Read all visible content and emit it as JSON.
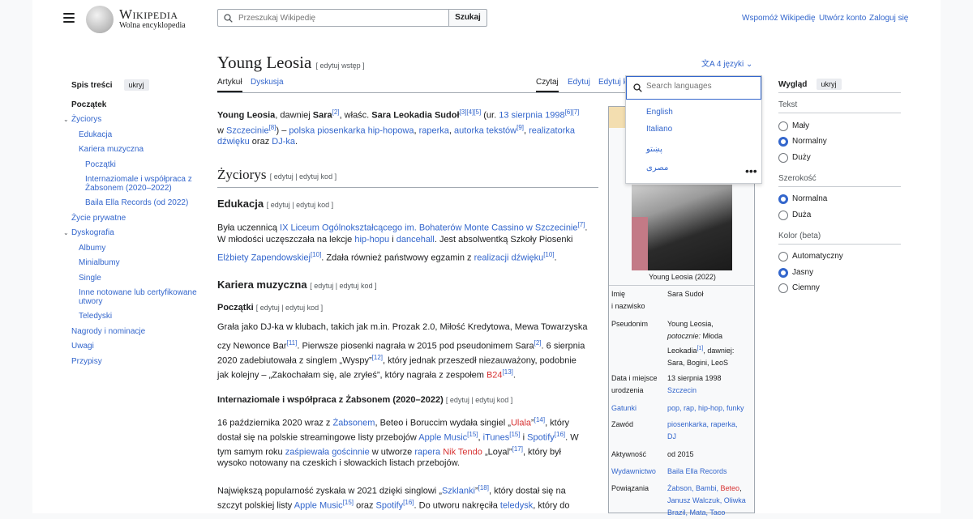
{
  "header": {
    "logo_title": "Wikipedia",
    "logo_subtitle": "Wolna encyklopedia",
    "search_placeholder": "Przeszukaj Wikipedię",
    "search_button": "Szukaj",
    "user_links": [
      "Wspomóż Wikipedię",
      "Utwórz konto",
      "Zaloguj się"
    ]
  },
  "toc": {
    "title": "Spis treści",
    "hide": "ukryj",
    "items": [
      "Początek",
      "Życiorys",
      "Edukacja",
      "Kariera muzyczna",
      "Początki",
      "Internaziomale i współpraca z",
      "Żabsonem (2020–2022)",
      "Baila Ella Records (od 2022)",
      "Życie prywatne",
      "Dyskografia",
      "Albumy",
      "Minialbumy",
      "Single",
      "Inne notowane lub certyfikowane",
      "utwory",
      "Teledyski",
      "Nagrody i nominacje",
      "Uwagi",
      "Przypisy"
    ]
  },
  "article": {
    "title": "Young Leosia",
    "edit_intro": "[ edytuj wstęp ]",
    "edit_links": "[ edytuj | edytuj kod ]",
    "lang_count": "4 języki",
    "tabs_left": [
      "Artykuł",
      "Dyskusja"
    ],
    "tabs_right": [
      "Czytaj",
      "Edytuj",
      "Edytuj k"
    ],
    "intro": {
      "l1a": "Young Leosia",
      "l1b": ", dawniej ",
      "l1c": "Sara",
      "l1d": "[2]",
      "l1e": ", właśc. ",
      "l1f": "Sara Leokadia Sudoł",
      "l1g": "[3][4][5]",
      "l1h": " (ur. ",
      "l1i": "13 sierpnia",
      "l1j": "1998",
      "l1k": "[6][7]",
      "l2a": "w ",
      "l2b": "Szczecinie",
      "l2c": "[8]",
      "l2d": ") – ",
      "l2e": "polska piosenkarka hip-hopowa",
      "l2f": ", ",
      "l2g": "raperka",
      "l2h": ", ",
      "l2i": "autorka tekstów",
      "l2j": "[9]",
      "l2k": ", ",
      "l2l": "realizatorka",
      "l3a": "dźwięku",
      "l3b": " oraz ",
      "l3c": "DJ-ka",
      "l3d": "."
    },
    "h_zyciorys": "Życiorys",
    "h_edukacja": "Edukacja",
    "edukacja": {
      "a1": "Była uczennicą ",
      "a2": "IX Liceum Ogólnokształcącego im. Bohaterów Monte Cassino w Szczecinie",
      "a3": "[7]",
      "a4": ".",
      "b1": "W młodości uczęszczała na lekcje ",
      "b2": "hip-hopu",
      "b3": " i ",
      "b4": "dancehall",
      "b5": ". Jest absolwentką Szkoły Piosenki",
      "c1": "Elżbiety Zapendowskiej",
      "c2": "[10]",
      "c3": ". Zdała również państwowy egzamin z ",
      "c4": "realizacji dźwięku",
      "c5": "[10]",
      "c6": "."
    },
    "h_kariera": "Kariera muzyczna",
    "h_poczatki": "Początki",
    "poczatki": {
      "a": "Grała jako DJ-ka w klubach, takich jak m.in. Prozak 2.0, Miłość Kredytowa, Mewa Towarzyska",
      "b1": "czy Newonce Bar",
      "b2": "[11]",
      "b3": ". Pierwsze piosenki nagrała w 2015 pod pseudonimem Sara",
      "b4": "[2]",
      "b5": ". 6 sierpnia",
      "c1": "2020 zadebiutowała z singlem „Wyspy”",
      "c2": "[12]",
      "c3": ", który jednak przeszedł niezauważony, podobnie",
      "d1": "jak kolejny – „Zakochałam się, ale zryłeś”, który nagrała z zespołem ",
      "d2": "B24",
      "d3": "[13]",
      "d4": "."
    },
    "h_internaziomale": "Internaziomale i współpraca z Żabsonem (2020–2022)",
    "internaziomale": {
      "a1": "16 października 2020 wraz z ",
      "a2": "Żabsonem",
      "a3": ", Beteo i Boruccim wydała singiel „",
      "a4": "Ulala",
      "a5": "”",
      "a6": "[14]",
      "a7": ", który",
      "b1": "dostał się na polskie streamingowe listy przebojów ",
      "b2": "Apple Music",
      "b3": "[15]",
      "b4": ", ",
      "b5": "iTunes",
      "b6": "[15]",
      "b7": " i ",
      "b8": "Spotify",
      "b9": "[16]",
      "b10": ". W",
      "c1": "tym samym roku ",
      "c2": "zaśpiewała gościnnie",
      "c3": " w utworze ",
      "c4": "rapera",
      "c5": " ",
      "c6": "Nik Tendo",
      "c7": " „Loyal”",
      "c8": "[17]",
      "c9": ", który był",
      "d": "wysoko notowany na czeskich i słowackich listach przebojów.",
      "e1": "Największą popularność zyskała w 2021 dzięki singlowi „",
      "e2": "Szklanki",
      "e3": "”",
      "e4": "[18]",
      "e5": ", który dostał się na",
      "f1": "szczyt polskiej listy ",
      "f2": "Apple Music",
      "f3": "[15]",
      "f4": " oraz ",
      "f5": "Spotify",
      "f6": "[16]",
      "f7": ". Do utworu nakręciła ",
      "f8": "teledysk",
      "f9": ", który do"
    }
  },
  "infobox": {
    "caption": "Young Leosia (2022)",
    "rows": {
      "imie_k1": "Imię",
      "imie_k2": "i nazwisko",
      "imie_v": "Sara Sudoł",
      "pseud_k": "Pseudonim",
      "pseud_v1": "Young Leosia,",
      "pseud_v2": "potocznie:",
      "pseud_v3": " Młoda",
      "pseud_v4": "Leokadia",
      "pseud_v5": "[1]",
      "pseud_v6": ", dawniej:",
      "pseud_v7": "Sara, Bogini, LeoS",
      "data_k1": "Data i miejsce",
      "data_k2": "urodzenia",
      "data_v1": "13 sierpnia 1998",
      "data_v2": "Szczecin",
      "gat_k": "Gatunki",
      "gat_v": "pop, rap, hip-hop, funky",
      "zaw_k": "Zawód",
      "zaw_v1": "piosenkarka, raperka,",
      "zaw_v2": "DJ",
      "akt_k": "Aktywność",
      "akt_v": "od 2015",
      "wyd_k": "Wydawnictwo",
      "wyd_v": "Baila Ella Records",
      "pow_k": "Powiązania",
      "pow_v1": "Żabson",
      "pow_v1b": ", Bambi, ",
      "pow_v1c": "Beteo",
      "pow_v1d": ",",
      "pow_v2": "Janusz Walczuk, Oliwka",
      "pow_v3": "Brazil, Mata, Taco"
    }
  },
  "languages": {
    "search_placeholder": "Search languages",
    "items": [
      "English",
      "Italiano",
      "پښتو",
      "مصرى"
    ],
    "more": "•••"
  },
  "appearance": {
    "title": "Wygląd",
    "hide": "ukryj",
    "text_label": "Tekst",
    "text_options": [
      "Mały",
      "Normalny",
      "Duży"
    ],
    "width_label": "Szerokość",
    "width_options": [
      "Normalna",
      "Duża"
    ],
    "color_label": "Kolor (beta)",
    "color_options": [
      "Automatyczny",
      "Jasny",
      "Ciemny"
    ]
  }
}
